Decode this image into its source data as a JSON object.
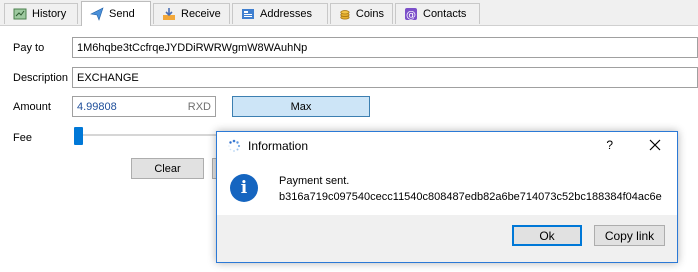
{
  "tabs": [
    {
      "label": "History",
      "icon": "history-icon"
    },
    {
      "label": "Send",
      "icon": "send-icon"
    },
    {
      "label": "Receive",
      "icon": "receive-icon"
    },
    {
      "label": "Addresses",
      "icon": "addresses-icon"
    },
    {
      "label": "Coins",
      "icon": "coins-icon"
    },
    {
      "label": "Contacts",
      "icon": "contacts-icon"
    }
  ],
  "active_tab": "Send",
  "form": {
    "pay_to_label": "Pay to",
    "pay_to_value": "1M6hqbe3tCcfrqeJYDDiRWRWgmW8WAuhNp",
    "description_label": "Description",
    "description_value": "EXCHANGE",
    "amount_label": "Amount",
    "amount_value": "4.99808",
    "amount_unit": "RXD",
    "max_label": "Max",
    "fee_label": "Fee",
    "clear_label": "Clear"
  },
  "dialog": {
    "title": "Information",
    "help": "?",
    "message_line1": "Payment sent.",
    "message_line2": "b316a719c097540cecc11540c808487edb82a6be714073c52bc188384f04ac6e",
    "ok_label": "Ok",
    "copy_label": "Copy link"
  },
  "colors": {
    "accent": "#0078d7",
    "max_button": "#cde5f7",
    "info_icon": "#1565c0"
  }
}
